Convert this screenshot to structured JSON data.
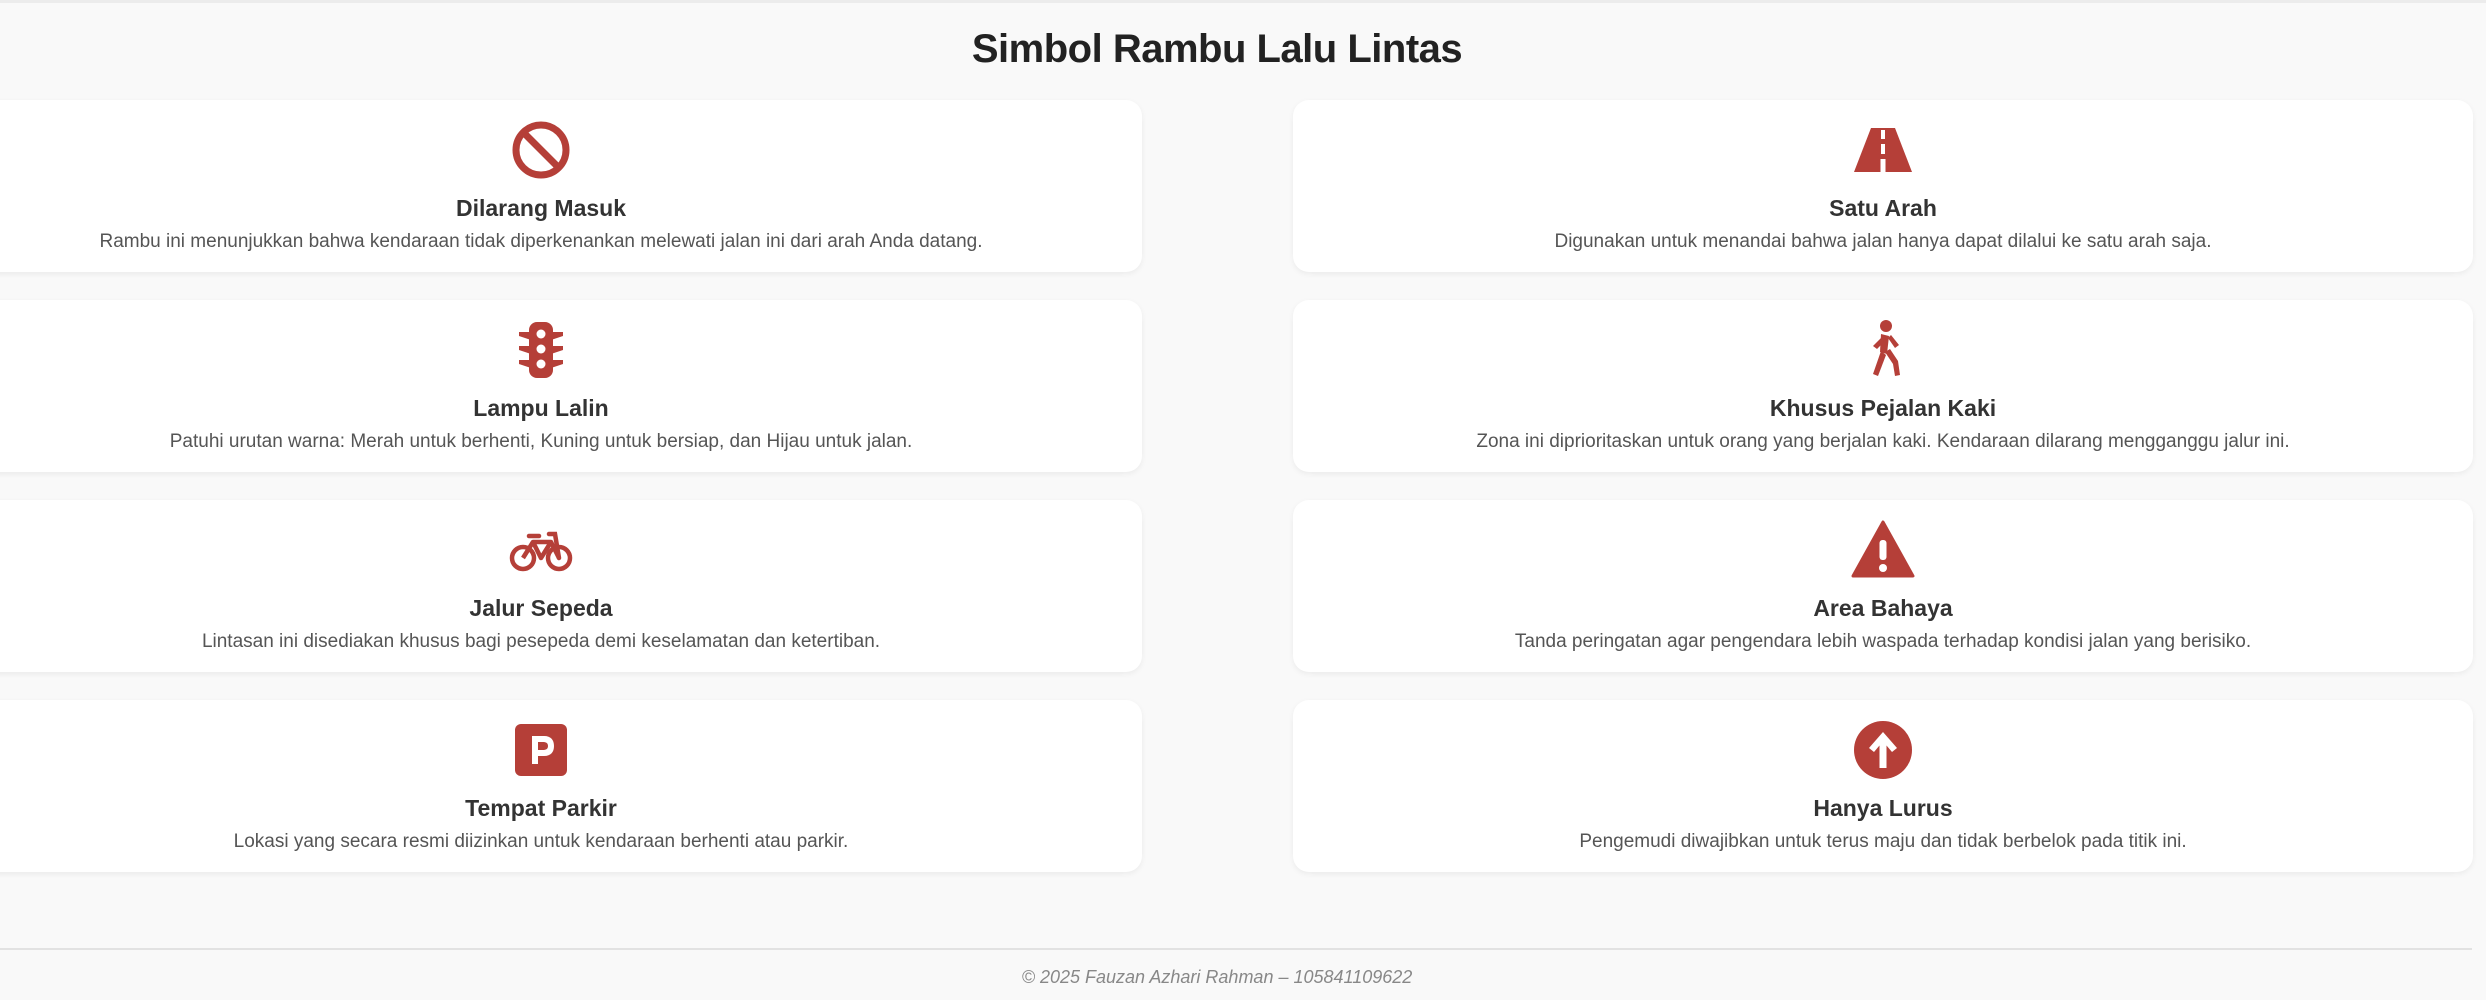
{
  "page": {
    "title": "Simbol Rambu Lalu Lintas",
    "footer": "© 2025 Fauzan Azhari Rahman – 105841109622"
  },
  "colors": {
    "icon": "#b53f38",
    "background": "#f9f9f9",
    "card": "#ffffff"
  },
  "signs": [
    {
      "icon": "ban-icon",
      "title": "Dilarang Masuk",
      "description": "Rambu ini menunjukkan bahwa kendaraan tidak diperkenankan melewati jalan ini dari arah Anda datang."
    },
    {
      "icon": "road-icon",
      "title": "Satu Arah",
      "description": "Digunakan untuk menandai bahwa jalan hanya dapat dilalui ke satu arah saja."
    },
    {
      "icon": "traffic-light-icon",
      "title": "Lampu Lalin",
      "description": "Patuhi urutan warna: Merah untuk berhenti, Kuning untuk bersiap, dan Hijau untuk jalan."
    },
    {
      "icon": "person-walking-icon",
      "title": "Khusus Pejalan Kaki",
      "description": "Zona ini diprioritaskan untuk orang yang berjalan kaki. Kendaraan dilarang mengganggu jalur ini."
    },
    {
      "icon": "bicycle-icon",
      "title": "Jalur Sepeda",
      "description": "Lintasan ini disediakan khusus bagi pesepeda demi keselamatan dan ketertiban."
    },
    {
      "icon": "warning-triangle-icon",
      "title": "Area Bahaya",
      "description": "Tanda peringatan agar pengendara lebih waspada terhadap kondisi jalan yang berisiko."
    },
    {
      "icon": "parking-icon",
      "title": "Tempat Parkir",
      "description": "Lokasi yang secara resmi diizinkan untuk kendaraan berhenti atau parkir."
    },
    {
      "icon": "arrow-up-circle-icon",
      "title": "Hanya Lurus",
      "description": "Pengemudi diwajibkan untuk terus maju dan tidak berbelok pada titik ini."
    }
  ]
}
